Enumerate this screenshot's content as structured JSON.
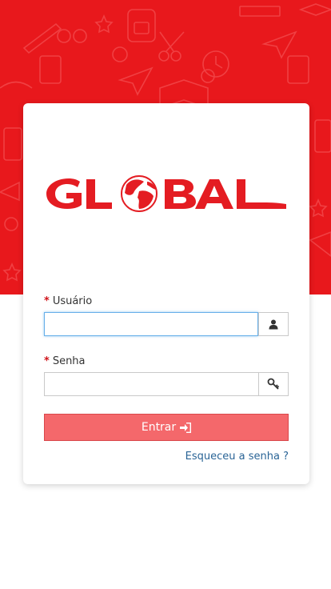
{
  "brand": {
    "logo_text": "GLOBAL",
    "primary_color": "#e8181c"
  },
  "form": {
    "username": {
      "label": "Usuário",
      "required_mark": "*",
      "value": "",
      "icon": "user-icon"
    },
    "password": {
      "label": "Senha",
      "required_mark": "*",
      "value": "",
      "icon": "key-icon"
    },
    "submit_label": "Entrar",
    "submit_icon": "sign-in-icon",
    "submit_color": "#f4686b",
    "forgot_label": "Esqueceu a senha ?",
    "link_color": "#2a6496"
  }
}
